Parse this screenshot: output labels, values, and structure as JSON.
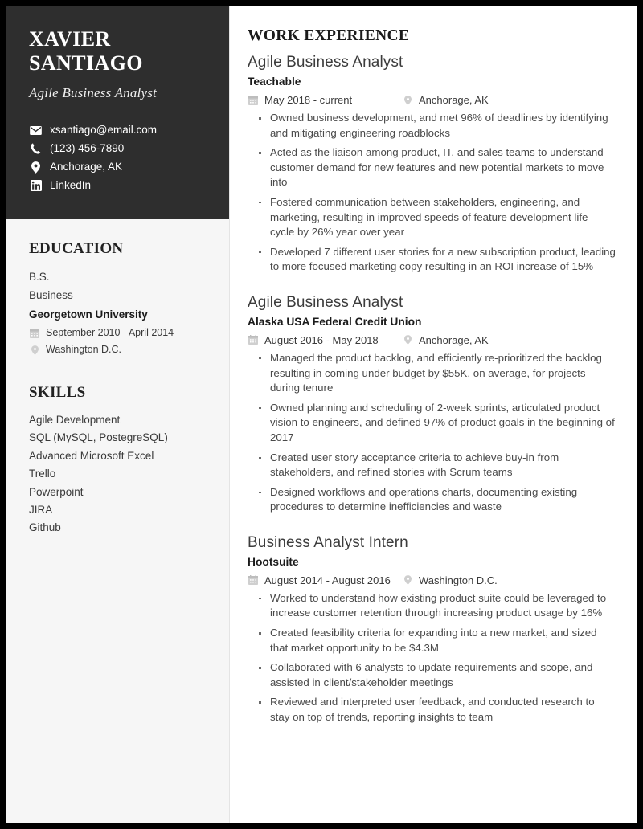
{
  "profile": {
    "first_name": "XAVIER",
    "last_name": "SANTIAGO",
    "role": "Agile Business Analyst",
    "contacts": [
      {
        "icon": "envelope-icon",
        "value": "xsantiago@email.com"
      },
      {
        "icon": "phone-icon",
        "value": "(123) 456-7890"
      },
      {
        "icon": "map-pin-icon",
        "value": "Anchorage, AK"
      },
      {
        "icon": "linkedin-icon",
        "value": "LinkedIn"
      }
    ]
  },
  "education": {
    "heading": "EDUCATION",
    "degree": "B.S.",
    "field": "Business",
    "school": "Georgetown University",
    "dates": "September 2010 - April 2014",
    "location": "Washington D.C."
  },
  "skills": {
    "heading": "SKILLS",
    "items": [
      "Agile Development",
      "SQL (MySQL, PostegreSQL)",
      "Advanced Microsoft Excel",
      "Trello",
      "Powerpoint",
      "JIRA",
      "Github"
    ]
  },
  "work": {
    "heading": "WORK EXPERIENCE",
    "jobs": [
      {
        "title": "Agile Business Analyst",
        "company": "Teachable",
        "dates": "May 2018 - current",
        "location": "Anchorage, AK",
        "bullets": [
          "Owned business development, and met 96% of deadlines by identifying and mitigating engineering roadblocks",
          "Acted as the liaison among product, IT, and sales teams to understand customer demand for new features and new potential markets to move into",
          "Fostered communication between stakeholders, engineering, and marketing, resulting in improved speeds of feature development life-cycle by 26% year over year",
          "Developed 7 different user stories for a new subscription product, leading to more focused marketing copy resulting in an ROI increase of 15%"
        ]
      },
      {
        "title": "Agile Business Analyst",
        "company": "Alaska USA Federal Credit Union",
        "dates": "August 2016 - May 2018",
        "location": "Anchorage, AK",
        "bullets": [
          "Managed the product backlog, and efficiently re-prioritized the backlog resulting in coming under budget by $55K, on average, for projects during tenure",
          "Owned planning and scheduling of 2-week sprints, articulated product vision to engineers, and defined 97% of product goals in the beginning of 2017",
          "Created user story acceptance criteria to achieve buy-in from stakeholders, and refined stories with Scrum teams",
          "Designed workflows and operations charts, documenting existing procedures to determine inefficiencies and waste"
        ]
      },
      {
        "title": "Business Analyst Intern",
        "company": "Hootsuite",
        "dates": "August 2014 - August 2016",
        "location": "Washington D.C.",
        "bullets": [
          "Worked to understand how existing product suite could be leveraged to increase customer retention through increasing product usage by 16%",
          "Created feasibility criteria for expanding into a new market, and sized that market opportunity to be $4.3M",
          "Collaborated with 6 analysts to update requirements and scope, and assisted in client/stakeholder meetings",
          "Reviewed and interpreted user feedback, and conducted research to stay on top of trends, reporting insights to team"
        ]
      }
    ]
  },
  "colors": {
    "header_background": "#2e2e2e",
    "sidebar_background": "#f6f6f6",
    "page_background": "#ffffff",
    "border": "#000000"
  }
}
